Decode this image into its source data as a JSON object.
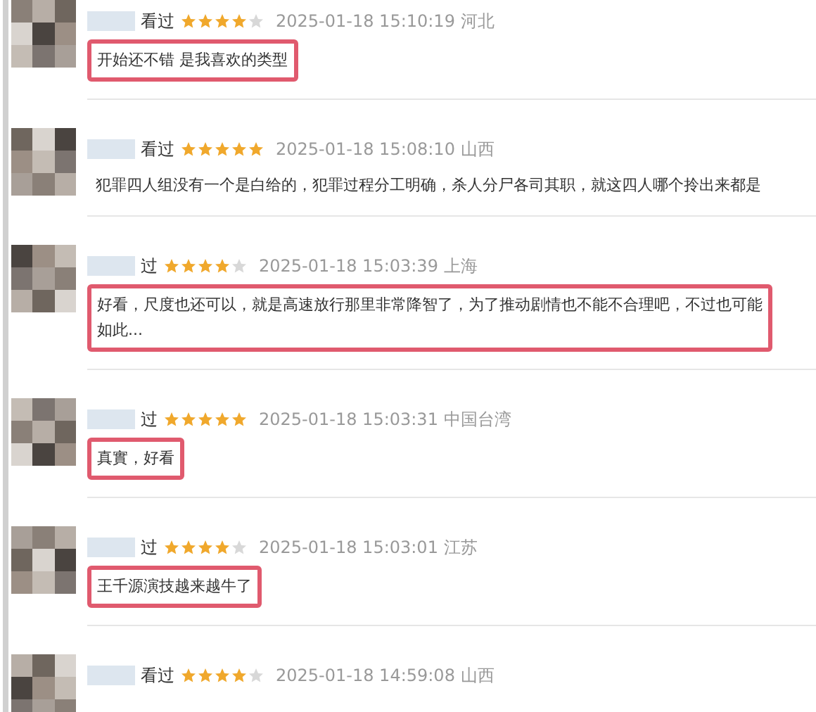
{
  "reviews": [
    {
      "label": "看过",
      "stars": 4,
      "time": "2025-01-18 15:10:19",
      "region": "河北",
      "lines": [
        "开始还不错 是我喜欢的类型"
      ],
      "highlighted": true
    },
    {
      "label": "看过",
      "stars": 5,
      "time": "2025-01-18 15:08:10",
      "region": "山西",
      "lines": [
        "犯罪四人组没有一个是白给的，犯罪过程分工明确，杀人分尸各司其职，就这四人哪个拎出来都是"
      ],
      "highlighted": false
    },
    {
      "label": "过",
      "stars": 4,
      "time": "2025-01-18 15:03:39",
      "region": "上海",
      "lines": [
        "好看，尺度也还可以，就是高速放行那里非常降智了，为了推动剧情也不能不合理吧，不过也可能",
        "如此..."
      ],
      "highlighted": true
    },
    {
      "label": "过",
      "stars": 5,
      "time": "2025-01-18 15:03:31",
      "region": "中国台湾",
      "lines": [
        "真實，好看"
      ],
      "highlighted": true
    },
    {
      "label": "过",
      "stars": 4,
      "time": "2025-01-18 15:03:01",
      "region": "江苏",
      "lines": [
        "王千源演技越来越牛了"
      ],
      "highlighted": true
    },
    {
      "label": "看过",
      "stars": 4,
      "time": "2025-01-18 14:59:08",
      "region": "山西"
    }
  ]
}
